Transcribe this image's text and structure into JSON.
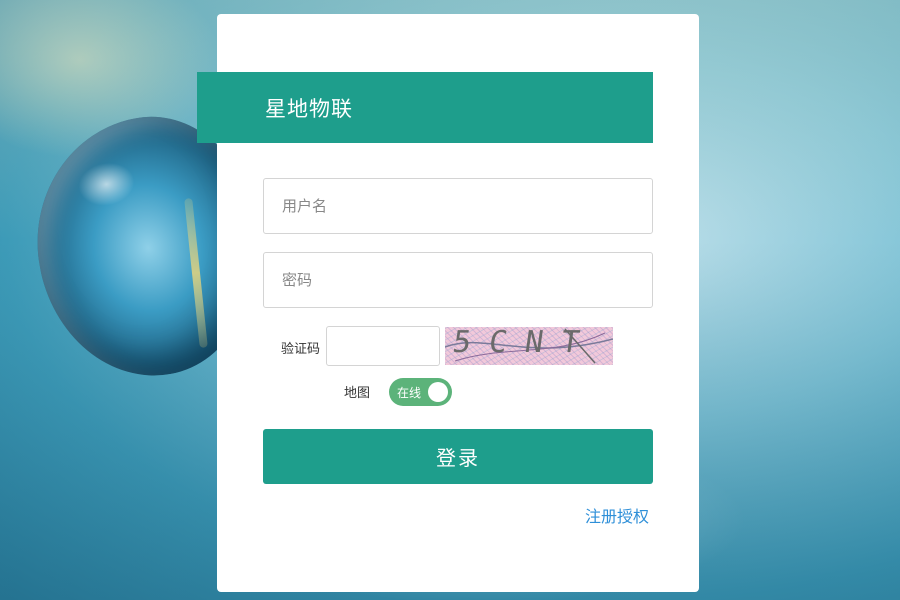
{
  "brand": {
    "title": "星地物联"
  },
  "login_form": {
    "username": {
      "placeholder": "用户名",
      "value": ""
    },
    "password": {
      "placeholder": "密码",
      "value": ""
    },
    "captcha": {
      "label": "验证码",
      "value": "",
      "image_text": "5CNT"
    },
    "map": {
      "label": "地图",
      "toggle_text": "在线",
      "toggle_on": true
    },
    "login_button": "登录",
    "register_link": "注册授权"
  },
  "colors": {
    "accent": "#1e9e8c",
    "toggle_on": "#5cb37a",
    "link": "#2e8fd8"
  }
}
